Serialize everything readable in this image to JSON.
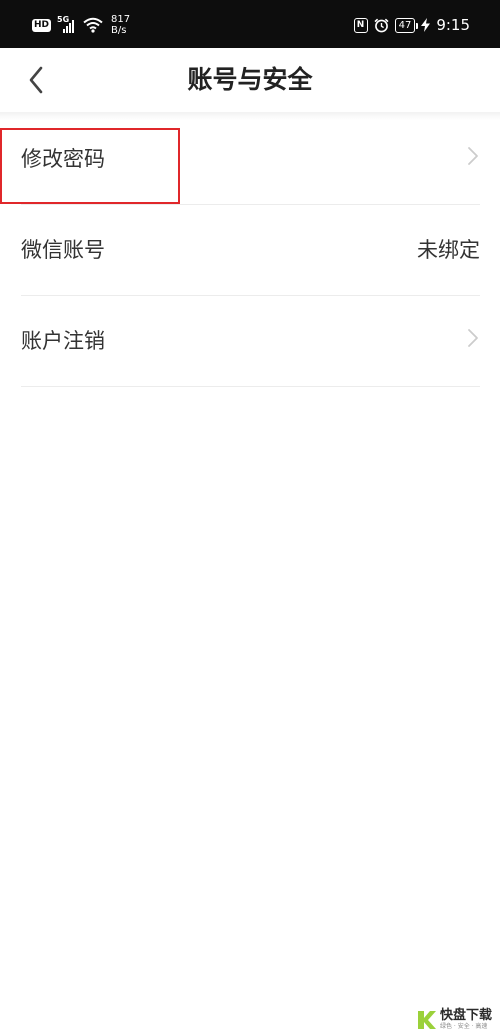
{
  "status_bar": {
    "hd": "HD",
    "network_type": "5G",
    "net_speed_value": "817",
    "net_speed_unit": "B/s",
    "nfc": "N",
    "battery": "47",
    "time": "9:15"
  },
  "header": {
    "title": "账号与安全",
    "back_icon": "chevron-left-icon"
  },
  "settings": {
    "items": [
      {
        "label": "修改密码",
        "value": "",
        "icon": "chevron-right-icon",
        "highlighted": true
      },
      {
        "label": "微信账号",
        "value": "未绑定"
      },
      {
        "label": "账户注销",
        "value": "",
        "icon": "chevron-right-icon"
      }
    ]
  },
  "watermark": {
    "main": "快盘下载",
    "sub": "绿色 · 安全 · 高速"
  },
  "colors": {
    "status_bar_bg": "#0d0d0d",
    "highlight_border": "#e0272a",
    "text_primary": "#333333",
    "chevron": "#cccccc"
  }
}
